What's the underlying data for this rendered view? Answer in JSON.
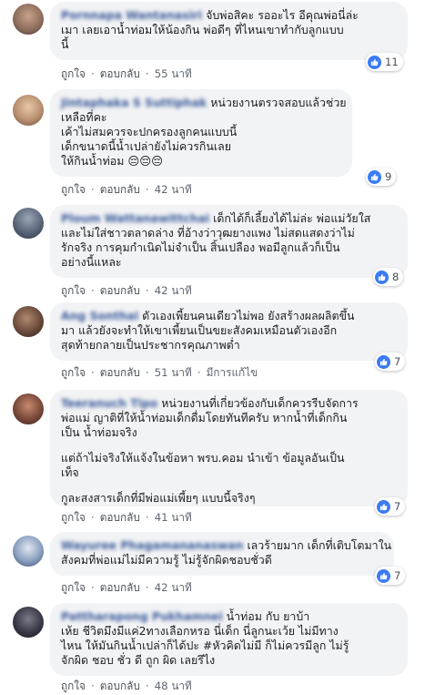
{
  "comments": [
    {
      "name": "Pornnapa Wantanasiri",
      "lines": [
        "จับพ่อสิคะ รออะไร อีคุณพ่อนี่ล่ะ",
        "เมา เลยเอาน้ำท่อมให้น้องกิน พ่อดีๆ ที่ไหนเขาทำกับลูกแบบ",
        "นี้"
      ],
      "likes_count": "11",
      "like_label": "ถูกใจ",
      "reply_label": "ตอบกลับ",
      "time": "55 นาที",
      "avatar_color": "#8a6a5a"
    },
    {
      "name": "Jintaphaka S Suttiphak",
      "lines": [
        "หน่วยงานตรวจสอบแล้วช่วย",
        "เหลือที่คะ",
        "เค้าไม่สมควรจะปกครองลูกคนแบบนี้",
        "เด็กขนาดนี้น้ำเปล่ายังไม่ควรกินเลย",
        "ให้กินน้ำท่อม 😔😔😔"
      ],
      "likes_count": "9",
      "like_label": "ถูกใจ",
      "reply_label": "ตอบกลับ",
      "time": "42 นาที",
      "avatar_color": "#b89070"
    },
    {
      "name": "Ploum Wattanawittchai",
      "lines": [
        "เด็กได้ก็เลี้ยงได้ไม่ล่ะ พ่อแม่วัยใส",
        "และไม่ใส่ชาวตลาดล่าง ที่อ้างว่าวุฒยางแพง ไม่สดแสดงว่าไม่",
        "รักจริง การคุมกำเนิดไม่จำเป็น สิ้นเปลือง พอมีลูกแล้วก็เป็น",
        "อย่างนี้แหละ"
      ],
      "likes_count": "8",
      "like_label": "ถูกใจ",
      "reply_label": "ตอบกลับ",
      "time": "42 นาที",
      "avatar_color": "#5a6578"
    },
    {
      "name": "Ang Sonthai",
      "lines": [
        "ตัวเองเพี้ยนคนเดียวไม่พอ ยังสร้างผลผลิตขึ้น",
        "มา แล้วยังจะทำให้เขาเพี้ยนเป็นขยะสังคมเหมือนตัวเองอีก",
        "สุดท้ายกลายเป็นประชากรคุณภาพต่ำ"
      ],
      "likes_count": "7",
      "like_label": "ถูกใจ",
      "reply_label": "ตอบกลับ",
      "time": "51 นาที",
      "edited_label": "มีการแก้ไข",
      "avatar_color": "#6a4a3a"
    },
    {
      "name": "Teeranuch Tipo",
      "lines": [
        "หน่วยงานที่เกี่ยวข้องกับเด็กควรรีบจัดการ",
        "พ่อแม่ ญาติที่ให้น้ำท่อมเด็กดื่มโดยทันทีครับ หากน้ำที่เด็กกิน",
        "เป็น น้ำท่อมจริง",
        "",
        "แต่ถ้าไม่จริงให้แจ้งในข้อหา พรบ.คอม นำเข้า ข้อมูลอันเป็น",
        "เท็จ",
        "",
        "กูละสงสารเด็กที่มีพ่อแม่เพี้ยๆ แบบนี้จริงๆ"
      ],
      "likes_count": "7",
      "like_label": "ถูกใจ",
      "reply_label": "ตอบกลับ",
      "time": "41 นาที",
      "avatar_color": "#7a4a3a"
    },
    {
      "name": "Wayuree Phagamananaswan",
      "lines": [
        "เลวร้ายมาก เด็กที่เติบโตมาใน",
        "สังคมที่พ่อแม่ไม่มีความรู้ ไม่รู้จักผิดชอบชั่วดี"
      ],
      "likes_count": "7",
      "like_label": "ถูกใจ",
      "reply_label": "ตอบกลับ",
      "time": "42 นาที",
      "avatar_color": "#8aa0c0"
    },
    {
      "name": "Pattharapong Pukhamnei",
      "lines": [
        "น้ำท่อม กับ ยาบ้า",
        "เห้ย ชีวิตมึงมีแค่2ทางเลือกหรอ นี่เด็ก นี่ลูกนะเว้ย ไม่มีทาง",
        "ไหน ให้มันกินน้ำเปล่าก็ได้ปะ #หัวคิดไม่มี ก็ไม่ควรมีลูก ไม่รู้",
        "จักผิด ชอบ ชั่ว ดี ถูก ผิด เลยรึไง"
      ],
      "like_label": "ถูกใจ",
      "reply_label": "ตอบกลับ",
      "time": "48 นาที",
      "avatar_color": "#3a3a48"
    }
  ]
}
